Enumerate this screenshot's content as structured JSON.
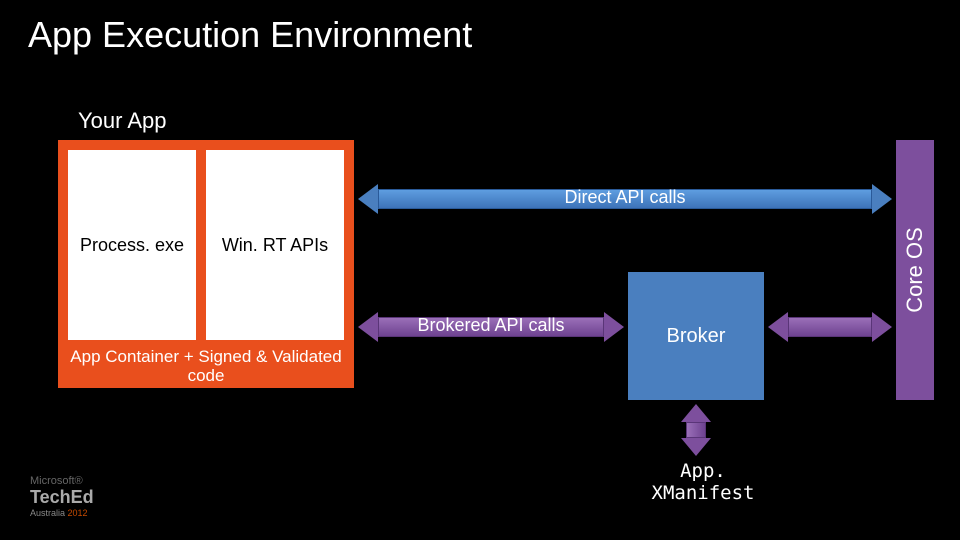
{
  "title": "App Execution Environment",
  "your_app": "Your App",
  "process": "Process. exe",
  "winrt": "Win. RT APIs",
  "container": "App Container + Signed & Validated code",
  "direct_calls": "Direct API calls",
  "brokered_calls": "Brokered API calls",
  "broker": "Broker",
  "core_os": "Core OS",
  "manifest": "App. XManifest",
  "logo": {
    "ms": "Microsoft®",
    "brand": "TechEd",
    "region": "Australia",
    "year": "2012"
  }
}
